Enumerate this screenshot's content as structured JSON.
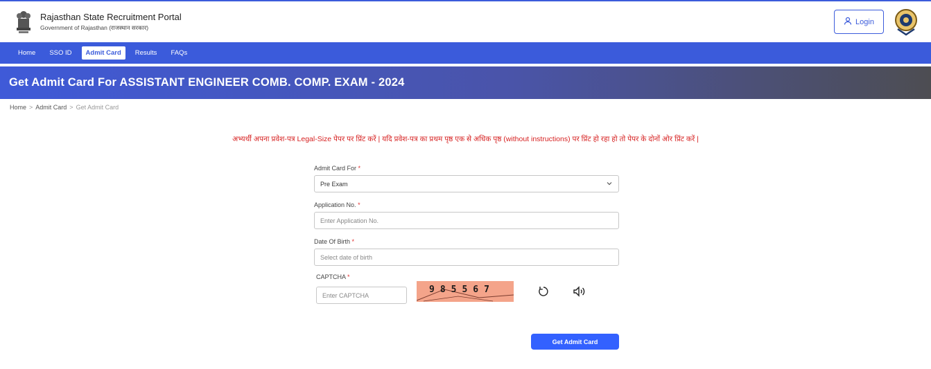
{
  "header": {
    "title": "Rajasthan State Recruitment Portal",
    "subtitle": "Government of Rajasthan (राजस्थान सरकार)",
    "login_label": "Login"
  },
  "nav": {
    "items": [
      "Home",
      "SSO ID",
      "Admit Card",
      "Results",
      "FAQs"
    ],
    "active": "Admit Card"
  },
  "banner": {
    "title": "Get Admit Card For ASSISTANT ENGINEER COMB. COMP. EXAM - 2024"
  },
  "breadcrumb": {
    "items": [
      "Home",
      "Admit Card",
      "Get Admit Card"
    ],
    "separator": ">"
  },
  "notice": "अभ्यर्थी अपना प्रवेश-पत्र Legal-Size पेपर पर प्रिंट करें | यदि प्रवेश-पत्र का प्रथम पृष्ठ एक से अधिक पृष्ठ (without instructions) पर प्रिंट हो रहा हो तो पेपर के दोनों ओर प्रिंट करें |",
  "form": {
    "admit_card_for": {
      "label": "Admit Card For",
      "value": "Pre Exam",
      "required_mark": "*"
    },
    "application_no": {
      "label": "Application No.",
      "placeholder": "Enter Application No.",
      "required_mark": "*"
    },
    "dob": {
      "label": "Date Of Birth",
      "placeholder": "Select date of birth",
      "required_mark": "*"
    },
    "captcha": {
      "label": "CAPTCHA",
      "placeholder": "Enter CAPTCHA",
      "required_mark": "*",
      "code": "985567"
    },
    "submit_label": "Get Admit Card"
  },
  "colors": {
    "primary": "#3b5bdb",
    "notice": "#d61f1f",
    "submit": "#3361ff",
    "captcha_bg": "#f4a48a"
  },
  "icons": [
    "emblem-icon",
    "user-icon",
    "seal-icon",
    "chevron-down-icon",
    "refresh-icon",
    "speaker-icon"
  ]
}
